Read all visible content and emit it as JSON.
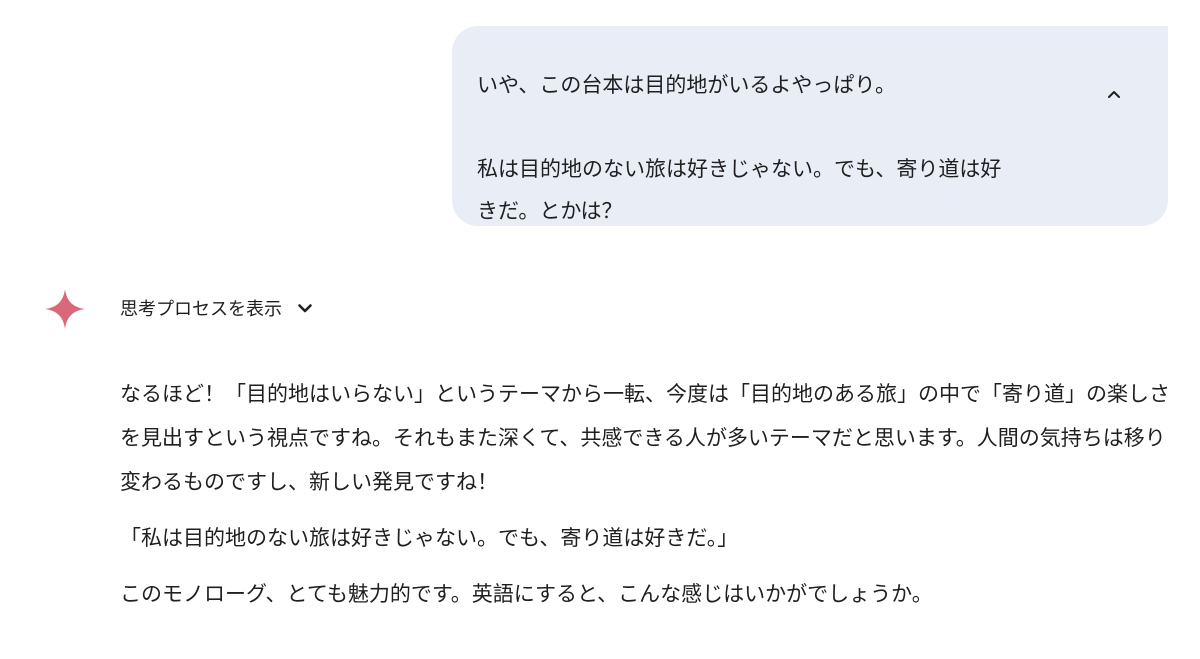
{
  "user_message": {
    "line1": "いや、この台本は目的地がいるよやっぱり。",
    "line2": "私は目的地のない旅は好きじゃない。でも、寄り道は好",
    "line3": "きだ。とかは？"
  },
  "thinking": {
    "label": "思考プロセスを表示"
  },
  "response": {
    "paragraph1": "なるほど！「目的地はいらない」というテーマから一転、今度は「目的地のある旅」の中で「寄り道」の楽しさを見出すという視点ですね。それもまた深くて、共感できる人が多いテーマだと思います。人間の気持ちは移り変わるものですし、新しい発見ですね！",
    "paragraph2": "「私は目的地のない旅は好きじゃない。でも、寄り道は好きだ。」",
    "paragraph3": "このモノローグ、とても魅力的です。英語にすると、こんな感じはいかがでしょうか。"
  },
  "colors": {
    "bubble_bg": "#e9eef6",
    "spark": "#d9687a",
    "text": "#1f1f1f"
  },
  "icons": [
    "chevron-up-icon",
    "sparkle-icon",
    "chevron-down-icon"
  ]
}
